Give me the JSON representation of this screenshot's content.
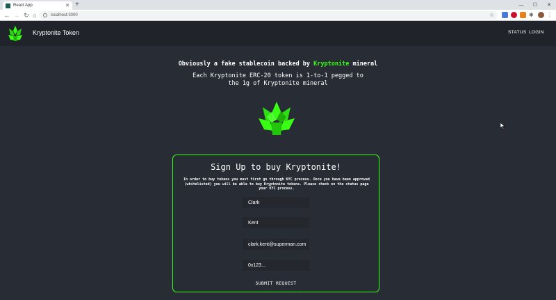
{
  "browser": {
    "tab_title": "React App",
    "tab_close": "✕",
    "new_tab": "+",
    "minimize": "—",
    "maximize": "☐",
    "close": "✕",
    "url": "localhost:3000"
  },
  "nav": {
    "brand": "Kryptonite Token",
    "links": [
      "STATUS",
      "LOGIN"
    ]
  },
  "hero": {
    "headline_prefix": "Obviously a fake stablecoin backed by ",
    "headline_highlight": "Kryptonite",
    "headline_suffix": " mineral",
    "subline": "Each Kryptonite ERC-20 token is 1-to-1 pegged to the 1g of Kryptonite mineral"
  },
  "form": {
    "title": "Sign Up to buy Kryptonite!",
    "description": "In order to buy tokens you must first go through KYC process. Once you have been approved (whitelisted) you will be able to buy Kryptonite tokens. Please check on the status page your KYC process.",
    "fields": [
      {
        "value": "Clark"
      },
      {
        "value": "Kent"
      },
      {
        "value": "clark.kent@superman.com"
      },
      {
        "value": "0x123..."
      }
    ],
    "submit_label": "SUBMIT REQUEST"
  },
  "colors": {
    "accent": "#39ff14",
    "background": "#282c34",
    "navbar": "#20232a"
  }
}
